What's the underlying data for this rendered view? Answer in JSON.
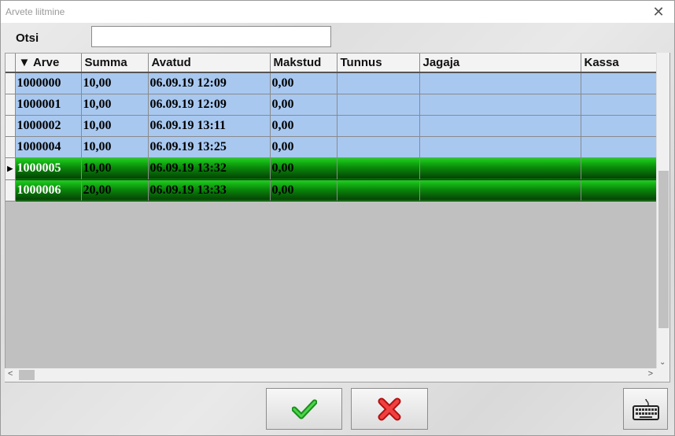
{
  "window": {
    "title": "Arvete liitmine",
    "close_icon": "close-icon"
  },
  "search": {
    "label": "Otsi",
    "value": "",
    "placeholder": ""
  },
  "grid": {
    "columns": [
      {
        "key": "arve",
        "label": "▼ Arve"
      },
      {
        "key": "summa",
        "label": "Summa"
      },
      {
        "key": "avatud",
        "label": "Avatud"
      },
      {
        "key": "makstud",
        "label": "Makstud"
      },
      {
        "key": "tunnus",
        "label": "Tunnus"
      },
      {
        "key": "jagaja",
        "label": "Jagaja"
      },
      {
        "key": "kassa",
        "label": "Kassa"
      }
    ],
    "rows": [
      {
        "arve": "1000000",
        "summa": "10,00",
        "avatud": "06.09.19 12:09",
        "makstud": "0,00",
        "tunnus": "",
        "jagaja": "",
        "kassa": "",
        "style": "normal"
      },
      {
        "arve": "1000001",
        "summa": "10,00",
        "avatud": "06.09.19 12:09",
        "makstud": "0,00",
        "tunnus": "",
        "jagaja": "",
        "kassa": "",
        "style": "normal"
      },
      {
        "arve": "1000002",
        "summa": "10,00",
        "avatud": "06.09.19 13:11",
        "makstud": "0,00",
        "tunnus": "",
        "jagaja": "",
        "kassa": "",
        "style": "normal"
      },
      {
        "arve": "1000004",
        "summa": "10,00",
        "avatud": "06.09.19 13:25",
        "makstud": "0,00",
        "tunnus": "",
        "jagaja": "",
        "kassa": "",
        "style": "normal"
      },
      {
        "arve": "1000005",
        "summa": "10,00",
        "avatud": "06.09.19 13:32",
        "makstud": "0,00",
        "tunnus": "",
        "jagaja": "",
        "kassa": "",
        "style": "green",
        "current": true
      },
      {
        "arve": "1000006",
        "summa": "20,00",
        "avatud": "06.09.19 13:33",
        "makstud": "0,00",
        "tunnus": "",
        "jagaja": "",
        "kassa": "",
        "style": "green"
      }
    ],
    "row_pointer_icon": "row-pointer-icon"
  },
  "buttons": {
    "ok": {
      "icon": "checkmark-icon",
      "color": "#22a822"
    },
    "cancel": {
      "icon": "red-x-icon",
      "color": "#e02020"
    },
    "keyboard": {
      "icon": "keyboard-icon"
    }
  },
  "colors": {
    "row_normal": "#a8c8f0",
    "row_selected_top": "#1fd41f",
    "row_selected_bottom": "#053f05",
    "grid_background": "#c0c0c0"
  }
}
